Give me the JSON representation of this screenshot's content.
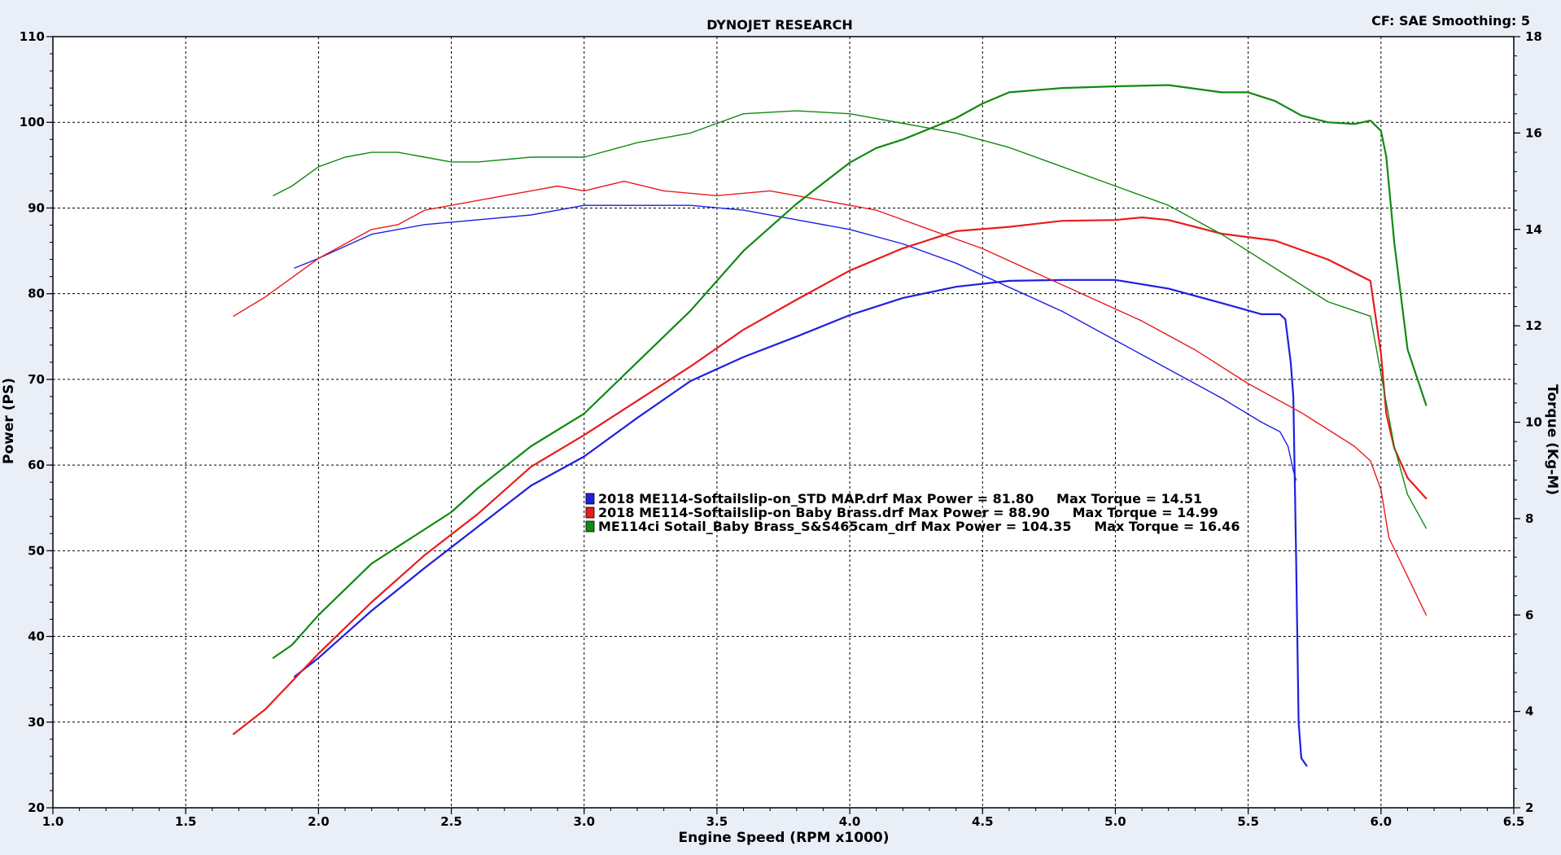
{
  "header": {
    "title": "DYNOJET RESEARCH",
    "cf_label": "CF: SAE  Smoothing: 5"
  },
  "chart_data": {
    "type": "line",
    "title": "DYNOJET RESEARCH",
    "xlabel": "Engine Speed (RPM x1000)",
    "ylabel_left": "Power (PS)",
    "ylabel_right": "Torque (Kg-M)",
    "xlim": [
      1.0,
      6.5
    ],
    "ylim_left": [
      20,
      110
    ],
    "ylim_right": [
      2,
      18
    ],
    "x_ticks": [
      "1.0",
      "1.5",
      "2.0",
      "2.5",
      "3.0",
      "3.5",
      "4.0",
      "4.5",
      "5.0",
      "5.5",
      "6.0",
      "6.5"
    ],
    "y_ticks_left": [
      "20",
      "30",
      "40",
      "50",
      "60",
      "70",
      "80",
      "90",
      "100",
      "110"
    ],
    "y_ticks_right": [
      "2",
      "4",
      "6",
      "8",
      "10",
      "12",
      "14",
      "16",
      "18"
    ],
    "grid": true,
    "legend_position": "center",
    "colors": {
      "blue": "#1f1fe0",
      "red": "#e81c1c",
      "green": "#118a11"
    },
    "legend": [
      {
        "label": "2018 ME114-Softailslip-on_STD MAP.drf Max Power = 81.80     Max Torque = 14.51",
        "color": "#1f1fe0"
      },
      {
        "label": "2018 ME114-Softailslip-on Baby Brass.drf Max Power = 88.90     Max Torque = 14.99",
        "color": "#e81c1c"
      },
      {
        "label": "ME114ci Sotail_Baby Brass_S&S465cam_drf Max Power = 104.35     Max Torque = 16.46",
        "color": "#118a11"
      }
    ],
    "series": [
      {
        "kind": "power",
        "axis": "left",
        "color": "#1f1fe0",
        "width": 2.2,
        "x": [
          1.91,
          2.0,
          2.2,
          2.4,
          2.6,
          2.8,
          3.0,
          3.2,
          3.4,
          3.6,
          3.8,
          4.0,
          4.2,
          4.4,
          4.6,
          4.8,
          5.0,
          5.2,
          5.4,
          5.55,
          5.62,
          5.64,
          5.66,
          5.67,
          5.68,
          5.69,
          5.7,
          5.72
        ],
        "y": [
          35.3,
          37.5,
          43.0,
          48.0,
          52.8,
          57.6,
          61.0,
          65.5,
          69.8,
          72.6,
          75.0,
          77.5,
          79.5,
          80.8,
          81.5,
          81.6,
          81.6,
          80.6,
          78.9,
          77.6,
          77.6,
          77.0,
          72.0,
          68.0,
          50.0,
          30.0,
          25.8,
          24.9
        ]
      },
      {
        "kind": "torque",
        "axis": "right",
        "color": "#1f1fe0",
        "width": 1.4,
        "x": [
          1.91,
          2.0,
          2.2,
          2.4,
          2.6,
          2.8,
          3.0,
          3.2,
          3.4,
          3.6,
          3.8,
          4.0,
          4.2,
          4.4,
          4.6,
          4.8,
          5.0,
          5.2,
          5.4,
          5.55,
          5.62,
          5.65,
          5.67,
          5.68
        ],
        "y": [
          13.2,
          13.4,
          13.9,
          14.1,
          14.2,
          14.3,
          14.5,
          14.5,
          14.5,
          14.4,
          14.2,
          14.0,
          13.7,
          13.3,
          12.8,
          12.3,
          11.7,
          11.1,
          10.5,
          10.0,
          9.8,
          9.5,
          9.0,
          8.8
        ]
      },
      {
        "kind": "power",
        "axis": "left",
        "color": "#e81c1c",
        "width": 2.2,
        "x": [
          1.68,
          1.8,
          2.0,
          2.2,
          2.4,
          2.6,
          2.8,
          3.0,
          3.2,
          3.4,
          3.6,
          3.8,
          4.0,
          4.2,
          4.4,
          4.6,
          4.8,
          5.0,
          5.1,
          5.2,
          5.4,
          5.6,
          5.8,
          5.96,
          6.0,
          6.02,
          6.05,
          6.1,
          6.17
        ],
        "y": [
          28.6,
          31.5,
          38.0,
          44.0,
          49.5,
          54.3,
          59.8,
          63.5,
          67.5,
          71.5,
          75.8,
          79.3,
          82.7,
          85.3,
          87.3,
          87.8,
          88.5,
          88.6,
          88.9,
          88.6,
          87.0,
          86.2,
          84.0,
          81.5,
          73.0,
          66.0,
          62.0,
          58.5,
          56.1
        ]
      },
      {
        "kind": "torque",
        "axis": "right",
        "color": "#e81c1c",
        "width": 1.4,
        "x": [
          1.68,
          1.8,
          2.0,
          2.2,
          2.3,
          2.4,
          2.6,
          2.8,
          2.9,
          3.0,
          3.15,
          3.3,
          3.5,
          3.7,
          3.9,
          4.1,
          4.3,
          4.5,
          4.7,
          4.9,
          5.1,
          5.3,
          5.5,
          5.7,
          5.9,
          5.96,
          6.0,
          6.03,
          6.1,
          6.17
        ],
        "y": [
          12.2,
          12.6,
          13.4,
          14.0,
          14.1,
          14.4,
          14.6,
          14.8,
          14.9,
          14.8,
          15.0,
          14.8,
          14.7,
          14.8,
          14.6,
          14.4,
          14.0,
          13.6,
          13.1,
          12.6,
          12.1,
          11.5,
          10.8,
          10.2,
          9.5,
          9.2,
          8.6,
          7.6,
          6.8,
          6.0
        ]
      },
      {
        "kind": "power",
        "axis": "left",
        "color": "#118a11",
        "width": 2.2,
        "x": [
          1.83,
          1.9,
          2.0,
          2.2,
          2.4,
          2.5,
          2.6,
          2.8,
          3.0,
          3.2,
          3.4,
          3.6,
          3.8,
          4.0,
          4.1,
          4.2,
          4.4,
          4.5,
          4.6,
          4.8,
          5.0,
          5.2,
          5.4,
          5.5,
          5.6,
          5.7,
          5.8,
          5.9,
          5.96,
          6.0,
          6.02,
          6.05,
          6.1,
          6.17
        ],
        "y": [
          37.5,
          39.0,
          42.5,
          48.5,
          52.5,
          54.5,
          57.3,
          62.2,
          66.0,
          72.0,
          78.0,
          85.0,
          90.5,
          95.3,
          97.0,
          98.0,
          100.5,
          102.2,
          103.5,
          104.0,
          104.2,
          104.35,
          103.5,
          103.5,
          102.5,
          100.8,
          100.0,
          99.8,
          100.2,
          99.0,
          96.0,
          86.0,
          73.5,
          67.0
        ]
      },
      {
        "kind": "torque",
        "axis": "right",
        "color": "#118a11",
        "width": 1.4,
        "x": [
          1.83,
          1.9,
          2.0,
          2.1,
          2.2,
          2.3,
          2.4,
          2.5,
          2.6,
          2.8,
          3.0,
          3.2,
          3.4,
          3.5,
          3.6,
          3.8,
          4.0,
          4.2,
          4.4,
          4.6,
          4.8,
          5.0,
          5.2,
          5.4,
          5.6,
          5.8,
          5.96,
          6.0,
          6.05,
          6.1,
          6.17
        ],
        "y": [
          14.7,
          14.9,
          15.3,
          15.5,
          15.6,
          15.6,
          15.5,
          15.4,
          15.4,
          15.5,
          15.5,
          15.8,
          16.0,
          16.2,
          16.4,
          16.46,
          16.4,
          16.2,
          16.0,
          15.7,
          15.3,
          14.9,
          14.5,
          13.9,
          13.2,
          12.5,
          12.2,
          11.0,
          9.5,
          8.5,
          7.8
        ]
      }
    ]
  }
}
